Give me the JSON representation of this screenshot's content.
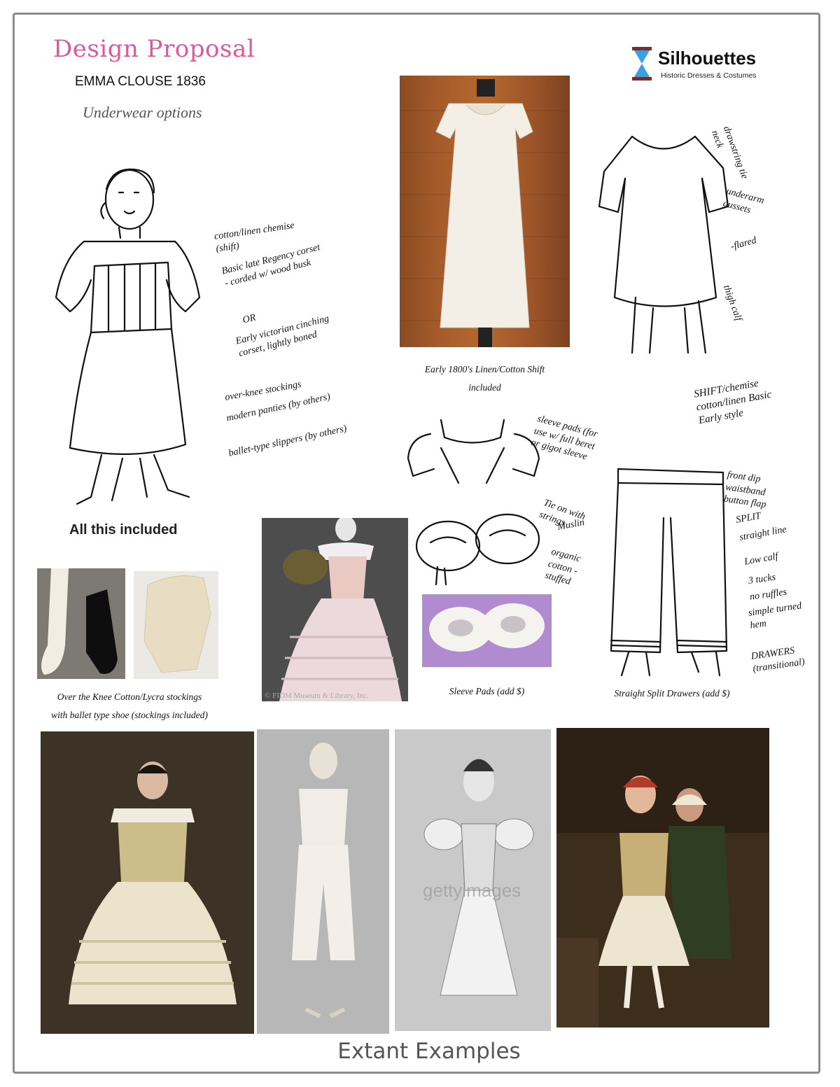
{
  "header": {
    "title": "Design Proposal",
    "subtitle": "EMMA CLOUSE 1836",
    "tagline": "Underwear options"
  },
  "logo": {
    "name": "Silhouettes",
    "tagline": "Historic Dresses & Costumes",
    "icon": "hourglass-icon",
    "accent": "#3aa0e0"
  },
  "figure_notes": {
    "chemise": "cotton/linen chemise (shift)",
    "corset": "Basic late Regency corset - corded w/ wood busk",
    "or": "OR",
    "victorian": "Early victorian cinching corset, lightly boned",
    "stockings": "over-knee stockings",
    "panties": "modern panties (by others)",
    "slippers": "ballet-type slippers (by others)"
  },
  "shift_notes": {
    "neck": "drawstring tie neck",
    "gussets": "underarm gussets",
    "flared": "-flared",
    "calf": "thigh calf",
    "label": "SHIFT/chemise cotton/linen Basic Early style"
  },
  "pads_notes": {
    "sleeve": "sleeve pads (for use w/ full beret or gigot sleeve",
    "tie": "Tie on with strings",
    "muslin": "Muslin",
    "organic": "organic cotton - stuffed"
  },
  "drawers_notes": {
    "waist": "front dip waistband button flap",
    "split": "SPLIT",
    "straight": "straight line",
    "calf": "Low calf",
    "tucks": "3 tucks",
    "ruffles": "no ruffles",
    "hem": "simple turned hem",
    "label": "DRAWERS (transitional)"
  },
  "captions": {
    "shift": "Early 1800's Linen/Cotton Shift",
    "shift_included": "included",
    "all_included": "All this included",
    "stockings_1": "Over the Knee Cotton/Lycra stockings",
    "stockings_2": "with ballet type shoe (stockings included)",
    "sleeve_pads": "Sleeve Pads (add $)",
    "drawers": "Straight Split Drawers (add $)",
    "museum_credit": "© FIDM Museum & Library, Inc.",
    "watermark": "gettyimages"
  },
  "footer": {
    "label": "Extant Examples"
  }
}
